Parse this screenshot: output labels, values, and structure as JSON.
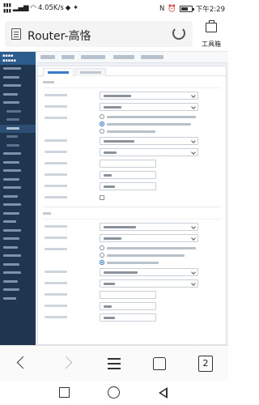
{
  "status_bar": {
    "network_speed": "4.05K/s",
    "time": "下午2:29"
  },
  "browser": {
    "page_title": "Router-高恪",
    "toolbox_label": "工具箱"
  },
  "browser_nav": {
    "tab_count": "2"
  }
}
